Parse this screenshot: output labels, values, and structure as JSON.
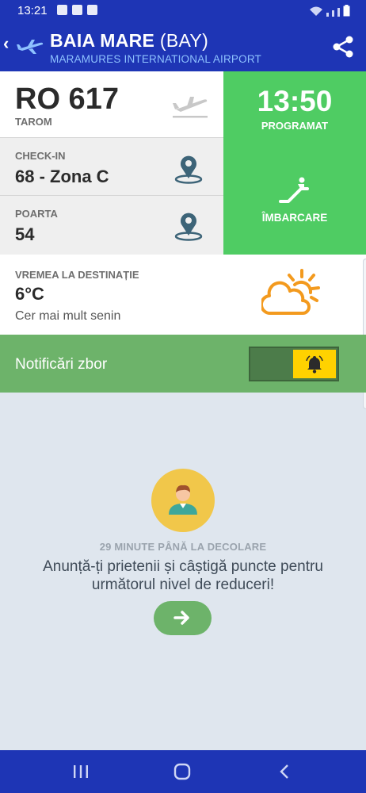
{
  "status_bar": {
    "time": "13:21"
  },
  "header": {
    "back_label": "‹",
    "city": "BAIA MARE",
    "code": "(BAY)",
    "airport": "MARAMURES INTERNATIONAL AIRPORT"
  },
  "flight": {
    "number": "RO 617",
    "airline": "TAROM"
  },
  "schedule": {
    "time": "13:50",
    "status": "PROGRAMAT"
  },
  "checkin": {
    "label": "CHECK-IN",
    "value": "68 - Zona C"
  },
  "gate": {
    "label": "POARTA",
    "value": "54"
  },
  "boarding": {
    "label": "ÎMBARCARE"
  },
  "weather": {
    "label": "VREMEA LA DESTINAȚIE",
    "temp": "6°C",
    "description": "Cer mai mult senin",
    "icon": "partly-sunny-icon"
  },
  "notifications": {
    "label": "Notificări zbor",
    "enabled": true
  },
  "promo": {
    "countdown": "29 MINUTE PÂNĂ LA DECOLARE",
    "message": "Anunță-ți prietenii și câștigă puncte pentru următorul nivel de reduceri!"
  },
  "colors": {
    "brand": "#1e35b5",
    "green": "#4fcc63",
    "notif_green": "#6db36a",
    "weather_orange": "#f39a1e",
    "bell_yellow": "#ffd200"
  }
}
